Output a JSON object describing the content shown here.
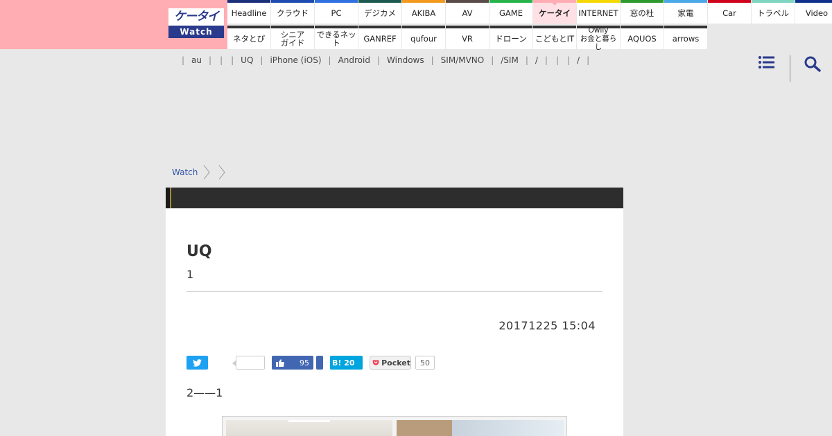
{
  "header": {
    "logo_top": "ケータイ",
    "logo_bottom": "Watch",
    "nav_row1": [
      {
        "label": "Headline",
        "color": "#1b2f7a"
      },
      {
        "label": "クラウド",
        "color": "#1e4bb0"
      },
      {
        "label": "PC",
        "color": "#2f6fe0"
      },
      {
        "label": "デジカメ",
        "color": "#1c5a4f"
      },
      {
        "label": "AKIBA",
        "color": "#f39a1e"
      },
      {
        "label": "AV",
        "color": "#5a4a4a"
      },
      {
        "label": "GAME",
        "color": "#26b34a"
      },
      {
        "label": "ケータイ",
        "color": "#ffadb3"
      },
      {
        "label": "INTERNET",
        "color": "#f5d800"
      },
      {
        "label": "窓の杜",
        "color": "#2e9a2e"
      },
      {
        "label": "家電",
        "color": "#4aa8e8"
      },
      {
        "label": "Car",
        "color": "#d0021b"
      },
      {
        "label": "トラベル",
        "color": "#7fd4c0"
      },
      {
        "label": "Video",
        "color": "#0e2f8a"
      }
    ],
    "nav_row2": [
      {
        "label": "ネタとぴ",
        "color": "#333333"
      },
      {
        "label": "シニアガイド",
        "color": "#333333"
      },
      {
        "label": "できるネット",
        "color": "#333333"
      },
      {
        "label": "GANREF",
        "color": "#333333"
      },
      {
        "label": "qufour",
        "color": "#333333"
      },
      {
        "label": "VR",
        "color": "#333333"
      },
      {
        "label": "ドローン",
        "color": "#333333"
      },
      {
        "label": "こどもとIT",
        "color": "#333333"
      },
      {
        "label": "Owlly お金と暮らし",
        "color": "#333333"
      },
      {
        "label": "AQUOS",
        "color": "#333333"
      },
      {
        "label": "arrows",
        "color": "#333333"
      }
    ]
  },
  "tagbar": [
    "|",
    "au",
    "|",
    "|",
    "|",
    "UQ",
    "|",
    "iPhone (iOS)",
    "|",
    "Android",
    "|",
    "Windows",
    "|",
    "SIM/MVNO",
    "|",
    "/SIM",
    "|",
    "/",
    "|",
    "|",
    "|",
    "/",
    "|"
  ],
  "icons": {
    "menu": "list-menu-icon",
    "search": "search-icon"
  },
  "breadcrumb": {
    "home": "Watch"
  },
  "article": {
    "title": "UQ",
    "subtitle": "1",
    "date": "20171225 15:04",
    "lead": "2——1",
    "social": {
      "facebook_count": "95",
      "hatena_label": "B! 20",
      "pocket_label": "Pocket",
      "pocket_count": "50"
    }
  }
}
